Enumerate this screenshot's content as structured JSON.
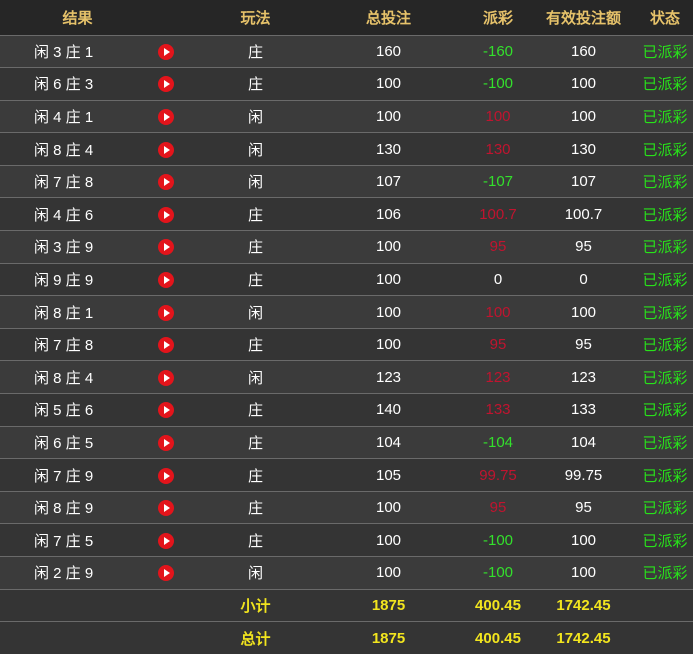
{
  "headers": {
    "result": "结果",
    "play": "玩法",
    "bet": "总投注",
    "payout": "派彩",
    "valid_bet": "有效投注额",
    "status": "状态"
  },
  "rows": [
    {
      "result": "闲 3 庄 1",
      "play": "庄",
      "bet": "160",
      "payout": "-160",
      "valid": "160",
      "status": "已派彩"
    },
    {
      "result": "闲 6 庄 3",
      "play": "庄",
      "bet": "100",
      "payout": "-100",
      "valid": "100",
      "status": "已派彩"
    },
    {
      "result": "闲 4 庄 1",
      "play": "闲",
      "bet": "100",
      "payout": "100",
      "valid": "100",
      "status": "已派彩"
    },
    {
      "result": "闲 8 庄 4",
      "play": "闲",
      "bet": "130",
      "payout": "130",
      "valid": "130",
      "status": "已派彩"
    },
    {
      "result": "闲 7 庄 8",
      "play": "闲",
      "bet": "107",
      "payout": "-107",
      "valid": "107",
      "status": "已派彩"
    },
    {
      "result": "闲 4 庄 6",
      "play": "庄",
      "bet": "106",
      "payout": "100.7",
      "valid": "100.7",
      "status": "已派彩"
    },
    {
      "result": "闲 3 庄 9",
      "play": "庄",
      "bet": "100",
      "payout": "95",
      "valid": "95",
      "status": "已派彩"
    },
    {
      "result": "闲 9 庄 9",
      "play": "庄",
      "bet": "100",
      "payout": "0",
      "valid": "0",
      "status": "已派彩"
    },
    {
      "result": "闲 8 庄 1",
      "play": "闲",
      "bet": "100",
      "payout": "100",
      "valid": "100",
      "status": "已派彩"
    },
    {
      "result": "闲 7 庄 8",
      "play": "庄",
      "bet": "100",
      "payout": "95",
      "valid": "95",
      "status": "已派彩"
    },
    {
      "result": "闲 8 庄 4",
      "play": "闲",
      "bet": "123",
      "payout": "123",
      "valid": "123",
      "status": "已派彩"
    },
    {
      "result": "闲 5 庄 6",
      "play": "庄",
      "bet": "140",
      "payout": "133",
      "valid": "133",
      "status": "已派彩"
    },
    {
      "result": "闲 6 庄 5",
      "play": "庄",
      "bet": "104",
      "payout": "-104",
      "valid": "104",
      "status": "已派彩"
    },
    {
      "result": "闲 7 庄 9",
      "play": "庄",
      "bet": "105",
      "payout": "99.75",
      "valid": "99.75",
      "status": "已派彩"
    },
    {
      "result": "闲 8 庄 9",
      "play": "庄",
      "bet": "100",
      "payout": "95",
      "valid": "95",
      "status": "已派彩"
    },
    {
      "result": "闲 7 庄 5",
      "play": "庄",
      "bet": "100",
      "payout": "-100",
      "valid": "100",
      "status": "已派彩"
    },
    {
      "result": "闲 2 庄 9",
      "play": "闲",
      "bet": "100",
      "payout": "-100",
      "valid": "100",
      "status": "已派彩"
    }
  ],
  "subtotal": {
    "label": "小计",
    "bet": "1875",
    "payout": "400.45",
    "valid": "1742.45"
  },
  "total": {
    "label": "总计",
    "bet": "1875",
    "payout": "400.45",
    "valid": "1742.45"
  },
  "colors": {
    "header_text": "#e6c26a",
    "payout_loss": "#33e02c",
    "payout_win": "#c0142f",
    "status_text": "#28e21a",
    "totals_text": "#f2e51e",
    "play_icon": "#e3141b"
  },
  "icons": {
    "row_action": "play-circle-icon"
  }
}
